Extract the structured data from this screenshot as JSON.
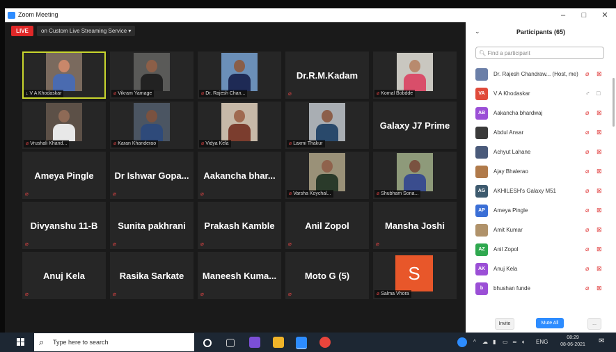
{
  "window": {
    "title": "Zoom Meeting",
    "minimize": "–",
    "maximize": "□",
    "close": "✕"
  },
  "topbar": {
    "live_label": "LIVE",
    "streaming_label": "on Custom Live Streaming Service ▾"
  },
  "tiles": [
    {
      "kind": "video",
      "label": "V A Khodaskar",
      "mic": "pin",
      "active": true,
      "tone": "#7a6a5e",
      "skin": "#c9876a",
      "shirt": "#4a6bb0"
    },
    {
      "kind": "video",
      "label": "Vikram Yamage",
      "mic": "muted",
      "tone": "#5a5a58",
      "skin": "#8c5f48",
      "shirt": "#222"
    },
    {
      "kind": "video",
      "label": "Dr. Rajesh Chan...",
      "mic": "muted",
      "tone": "#6b8fb8",
      "skin": "#8a5e48",
      "shirt": "#1e2a55"
    },
    {
      "kind": "name",
      "name": "Dr.R.M.Kadam",
      "mic": "muted"
    },
    {
      "kind": "video",
      "label": "Komal Bobdde",
      "mic": "muted",
      "tone": "#c9c7c0",
      "skin": "#b88a6e",
      "shirt": "#d94e6a"
    },
    {
      "kind": "video",
      "label": "Vrushali Khand...",
      "mic": "muted",
      "tone": "#5c5047",
      "skin": "#8e6a56",
      "shirt": "#e8e8e8"
    },
    {
      "kind": "video",
      "label": "Karan Khanderao",
      "mic": "muted",
      "tone": "#4b5562",
      "skin": "#7a5240",
      "shirt": "#2e4a7a"
    },
    {
      "kind": "video",
      "label": "Vidya Kela",
      "mic": "muted",
      "tone": "#c7b9a8",
      "skin": "#a06a50",
      "shirt": "#7b3d2e"
    },
    {
      "kind": "video",
      "label": "Laxmi Thakur",
      "mic": "muted",
      "tone": "#a9aeb3",
      "skin": "#8c5f4a",
      "shirt": "#29496b"
    },
    {
      "kind": "name",
      "name": "Galaxy J7 Prime",
      "mic": "none"
    },
    {
      "kind": "name",
      "name": "Ameya Pingle",
      "mic": "muted"
    },
    {
      "kind": "name",
      "name": "Dr Ishwar Gopa...",
      "mic": "muted"
    },
    {
      "kind": "name",
      "name": "Aakancha bhar...",
      "mic": "muted"
    },
    {
      "kind": "video",
      "label": "Varsha Koychal...",
      "mic": "muted",
      "tone": "#9a9178",
      "skin": "#8f624c",
      "shirt": "#2a3a2a"
    },
    {
      "kind": "video",
      "label": "Shubham Sona...",
      "mic": "muted",
      "tone": "#8e9a7a",
      "skin": "#7a5240",
      "shirt": "#3a4d8e"
    },
    {
      "kind": "name",
      "name": "Divyanshu 11-B",
      "mic": "muted"
    },
    {
      "kind": "name",
      "name": "Sunita pakhrani",
      "mic": "muted"
    },
    {
      "kind": "name",
      "name": "Prakash Kamble",
      "mic": "muted"
    },
    {
      "kind": "name",
      "name": "Anil Zopol",
      "mic": "muted"
    },
    {
      "kind": "name",
      "name": "Mansha Joshi",
      "mic": "muted"
    },
    {
      "kind": "name",
      "name": "Anuj Kela",
      "mic": "muted"
    },
    {
      "kind": "name",
      "name": "Rasika Sarkate",
      "mic": "muted"
    },
    {
      "kind": "name",
      "name": "Maneesh Kuma...",
      "mic": "muted"
    },
    {
      "kind": "name",
      "name": "Moto G (5)",
      "mic": "muted"
    },
    {
      "kind": "avatar",
      "letter": "S",
      "label": "Salma Vhora",
      "mic": "muted"
    }
  ],
  "panel": {
    "collapse": "⌄",
    "title": "Participants (65)",
    "search_placeholder": "Find a participant",
    "participants": [
      {
        "avatar": "",
        "photo": true,
        "photo_color": "#6b7fa8",
        "name": "Dr. Rajesh Chandraw... (Host, me)",
        "state": "muted"
      },
      {
        "avatar": "VA",
        "color": "#e04a3a",
        "name": "V A Khodaskar",
        "state": "on"
      },
      {
        "avatar": "AB",
        "color": "#9b4fd6",
        "name": "Aakancha bhardwaj",
        "state": "muted"
      },
      {
        "avatar": "",
        "photo": true,
        "photo_color": "#3a3a3a",
        "name": "Abdul Ansar",
        "state": "muted"
      },
      {
        "avatar": "",
        "photo": true,
        "photo_color": "#4a5a7a",
        "name": "Achyut Lahane",
        "state": "muted"
      },
      {
        "avatar": "",
        "photo": true,
        "photo_color": "#b07a4a",
        "name": "Ajay Bhalerao",
        "state": "muted"
      },
      {
        "avatar": "AG",
        "color": "#3d5a6e",
        "name": "AKHILESH's Galaxy M51",
        "state": "muted"
      },
      {
        "avatar": "AP",
        "color": "#3b6fd6",
        "name": "Ameya Pingle",
        "state": "muted"
      },
      {
        "avatar": "",
        "photo": true,
        "photo_color": "#b0926a",
        "name": "Amit Kumar",
        "state": "muted"
      },
      {
        "avatar": "AZ",
        "color": "#2fa84f",
        "name": "Anil Zopol",
        "state": "muted"
      },
      {
        "avatar": "AK",
        "color": "#9b4fd6",
        "name": "Anuj Kela",
        "state": "muted"
      },
      {
        "avatar": "b",
        "color": "#9b4fd6",
        "name": "bhushan funde",
        "state": "muted"
      }
    ],
    "invite_label": "Invite",
    "mute_all_label": "Mute All",
    "more_label": "..."
  },
  "taskbar": {
    "search_placeholder": "Type here to search",
    "tray_lang": "ENG",
    "clock_time": "08:29",
    "clock_date": "08-06-2021"
  }
}
